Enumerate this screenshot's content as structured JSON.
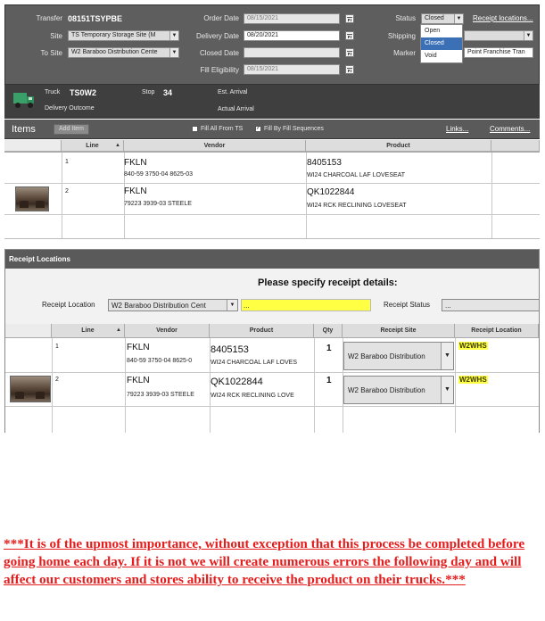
{
  "header": {
    "transfer_label": "Transfer",
    "transfer_value": "08151TSYPBE",
    "site_label": "Site",
    "site_value": "TS  Temporary Storage Site  (M",
    "to_site_label": "To Site",
    "to_site_value": "W2  Baraboo Distribution Cente",
    "order_date_label": "Order Date",
    "order_date_value": "08/15/2021",
    "delivery_date_label": "Delivery Date",
    "delivery_date_value": "08/20/2021",
    "closed_date_label": "Closed Date",
    "closed_date_value": "",
    "fill_eligibility_label": "Fill Eligibility",
    "fill_eligibility_value": "08/15/2021",
    "status_label": "Status",
    "status_value": "Closed",
    "status_options": [
      "Open",
      "Closed",
      "Void"
    ],
    "shipping_label": "Shipping",
    "marker_label": "Marker",
    "marker_value": "Point Franchise Tran",
    "receipt_locations_link": "Receipt locations..."
  },
  "truck": {
    "truck_label": "Truck",
    "truck_value": "TS0W2",
    "stop_label": "Stop",
    "stop_value": "34",
    "est_arrival_label": "Est. Arrival",
    "actual_arrival_label": "Actual Arrival",
    "delivery_outcome_label": "Delivery Outcome"
  },
  "items_bar": {
    "title": "Items",
    "add_item": "Add Item",
    "fill_all_from_ts": "Fill All From TS",
    "fill_by_sequences": "Fill By Fill Sequences",
    "links": "Links...",
    "comments": "Comments..."
  },
  "items_table": {
    "headers": [
      "Line",
      "Vendor",
      "Product"
    ],
    "rows": [
      {
        "line": "1",
        "vendor": "FKLN",
        "vendor_sub": "840-59 3750-04 8625-03",
        "product": "8405153",
        "product_sub": "WI24 CHARCOAL LAF LOVESEAT"
      },
      {
        "line": "2",
        "vendor": "FKLN",
        "vendor_sub": "79223 3939-03 STEELE",
        "product": "QK1022844",
        "product_sub": "WI24 RCK RECLINING LOVESEAT"
      }
    ]
  },
  "receipt": {
    "panel_title": "Receipt Locations",
    "prompt": "Please specify receipt details:",
    "location_label": "Receipt Location",
    "location_value": "W2  Baraboo Distribution Cent",
    "status_label": "Receipt Status",
    "status_value": "...",
    "headers": [
      "Line",
      "Vendor",
      "Product",
      "Qty",
      "Receipt Site",
      "Receipt Location"
    ],
    "rows": [
      {
        "line": "1",
        "vendor": "FKLN",
        "vendor_sub": "840-59 3750-04 8625-0",
        "product": "8405153",
        "product_sub": "WI24 CHARCOAL LAF LOVES",
        "qty": "1",
        "site": "W2  Baraboo Distribution",
        "location": "W2WHS"
      },
      {
        "line": "2",
        "vendor": "FKLN",
        "vendor_sub": "79223 3939-03 STEELE",
        "product": "QK1022844",
        "product_sub": "WI24 RCK RECLINING LOVE",
        "qty": "1",
        "site": "W2  Baraboo Distribution",
        "location": "W2WHS"
      }
    ]
  },
  "note": {
    "text": "***It is of the upmost importance, without exception that this process be completed before going home each day.   If it is not we will create numerous errors the following day and will affect our customers and stores ability to receive the product on their trucks.***"
  },
  "colors": {
    "panel_dark": "#5e5e5e",
    "dropdown_selected": "#3b6fb6",
    "highlight": "#ffff44",
    "note_red": "#e41c1c"
  }
}
